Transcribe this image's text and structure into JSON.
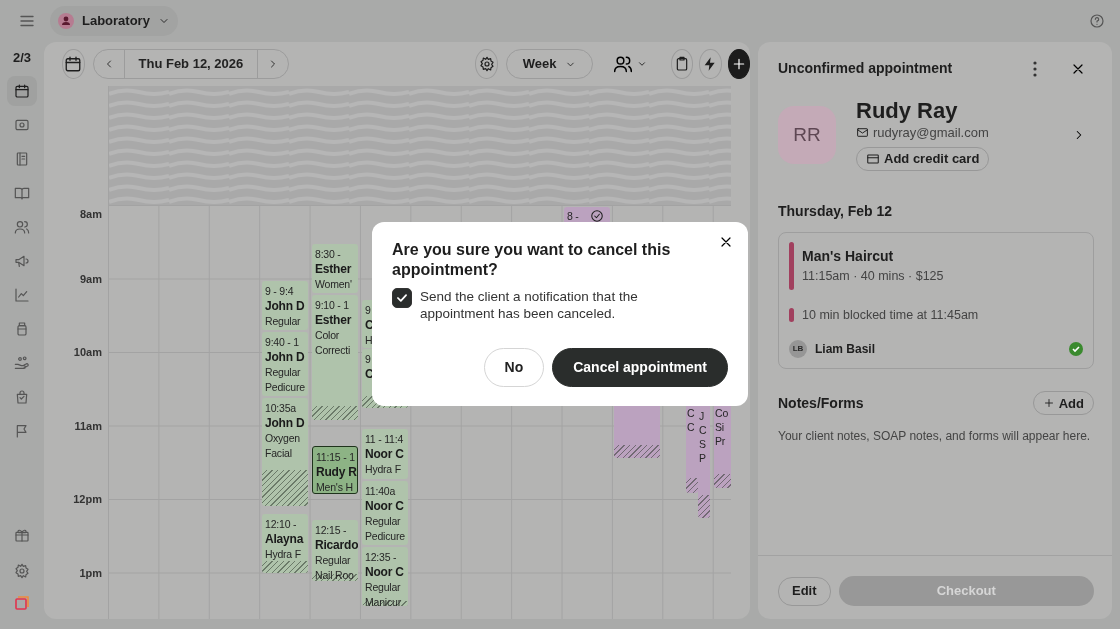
{
  "top_bar": {
    "location": "Laboratory"
  },
  "sidebar": {
    "page_indicator": "2/3",
    "items": [
      {
        "selected": true
      },
      {
        "selected": false
      },
      {
        "selected": false
      },
      {
        "selected": false
      },
      {
        "selected": false
      },
      {
        "selected": false
      },
      {
        "selected": false
      },
      {
        "selected": false
      },
      {
        "selected": false
      },
      {
        "selected": false
      },
      {
        "selected": false
      }
    ]
  },
  "toolbar": {
    "date": "Thu Feb 12, 2026",
    "view": "Week"
  },
  "calendar": {
    "hours": [
      "8am",
      "9am",
      "10am",
      "11am",
      "12pm",
      "1pm"
    ],
    "events": [
      {
        "lines": [
          "9 - 9:4",
          "John D",
          "Regular"
        ],
        "color": "#afc3ab",
        "selected": false,
        "buffer": false,
        "confirmed": false
      },
      {
        "lines": [
          "9:40 - 1",
          "John D",
          "Regular",
          "Pedicure"
        ],
        "color": "#afc3ab",
        "selected": false,
        "buffer": false,
        "confirmed": false
      },
      {
        "lines": [
          "10:35a",
          "John D",
          "Oxygen",
          "Facial"
        ],
        "color": "#afc3ab",
        "selected": false,
        "buffer": true,
        "confirmed": false
      },
      {
        "lines": [
          "12:10 -",
          "Alayna",
          "Hydra F"
        ],
        "color": "#afc3ab",
        "selected": false,
        "buffer": true,
        "confirmed": false
      },
      {
        "lines": [
          "8:30 -",
          "Esther",
          "Women'"
        ],
        "color": "#afc3ab",
        "selected": false,
        "buffer": false,
        "confirmed": false
      },
      {
        "lines": [
          "9:10 - 1",
          "Esther",
          "Color",
          "Correcti"
        ],
        "color": "#afc3ab",
        "selected": false,
        "buffer": true,
        "confirmed": false
      },
      {
        "lines": [
          "11:15 - 1",
          "Rudy R",
          "Men's H"
        ],
        "color": "#8db385",
        "selected": true,
        "buffer": false,
        "confirmed": false
      },
      {
        "lines": [
          "12:15 -",
          "Ricardo",
          "Regular",
          "Nail Roo"
        ],
        "color": "#afc3ab",
        "selected": false,
        "buffer": true,
        "confirmed": false
      },
      {
        "lines": [
          "9",
          "C",
          "H"
        ],
        "color": "#afc3ab",
        "selected": false,
        "buffer": false,
        "confirmed": false
      },
      {
        "lines": [
          "9",
          "C"
        ],
        "color": "#afc3ab",
        "selected": false,
        "buffer": true,
        "confirmed": false
      },
      {
        "lines": [
          "11 - 11:4",
          "Noor C",
          "Hydra F"
        ],
        "color": "#afc3ab",
        "selected": false,
        "buffer": false,
        "confirmed": false
      },
      {
        "lines": [
          "11:40a",
          "Noor C",
          "Regular",
          "Pedicure"
        ],
        "color": "#afc3ab",
        "selected": false,
        "buffer": false,
        "confirmed": false
      },
      {
        "lines": [
          "12:35 -",
          "Noor C",
          "Regular",
          "Manicur"
        ],
        "color": "#afc3ab",
        "selected": false,
        "buffer": true,
        "confirmed": false
      },
      {
        "lines": [
          "8 -"
        ],
        "color": "#bba2bf",
        "selected": false,
        "buffer": false,
        "confirmed": true
      },
      {
        "color": "#bba2bf",
        "selected": false,
        "buffer": true,
        "confirmed": false
      },
      {
        "lines": [
          "C",
          "C"
        ],
        "color": "#bba2bf",
        "selected": false,
        "buffer": true,
        "confirmed": false
      },
      {
        "lines": [
          "J",
          "C",
          "S",
          "P"
        ],
        "color": "#bba2bf",
        "selected": false,
        "buffer": true,
        "confirmed": false
      },
      {
        "lines": [
          "Co",
          "Si",
          "Pr"
        ],
        "color": "#bba2bf",
        "selected": false,
        "buffer": true,
        "confirmed": false
      }
    ]
  },
  "details": {
    "title": "Unconfirmed appointment",
    "client": {
      "initials": "RR",
      "name": "Rudy Ray",
      "email": "rudyray@gmail.com",
      "add_card": "Add credit card"
    },
    "date": "Thursday, Feb 12",
    "service": {
      "name": "Man's Haircut",
      "meta": "11:15am · 40 mins · $125",
      "blocked": "10 min blocked time at 11:45am",
      "staff_initials": "LB",
      "staff": "Liam Basil",
      "confirmed": true
    },
    "notes": {
      "title": "Notes/Forms",
      "add": "Add",
      "empty": "Your client notes, SOAP notes, and forms will appear here."
    },
    "footer": {
      "edit": "Edit",
      "checkout": {
        "label": "Checkout",
        "disabled": true
      }
    }
  },
  "modal": {
    "title": "Are you sure you want to cancel this appointment?",
    "notify": {
      "label": "Send the client a notification that the appointment has been canceled.",
      "checked": true
    },
    "buttons": [
      {
        "label": "No",
        "kind": "secondary"
      },
      {
        "label": "Cancel appointment",
        "kind": "primary"
      }
    ]
  }
}
